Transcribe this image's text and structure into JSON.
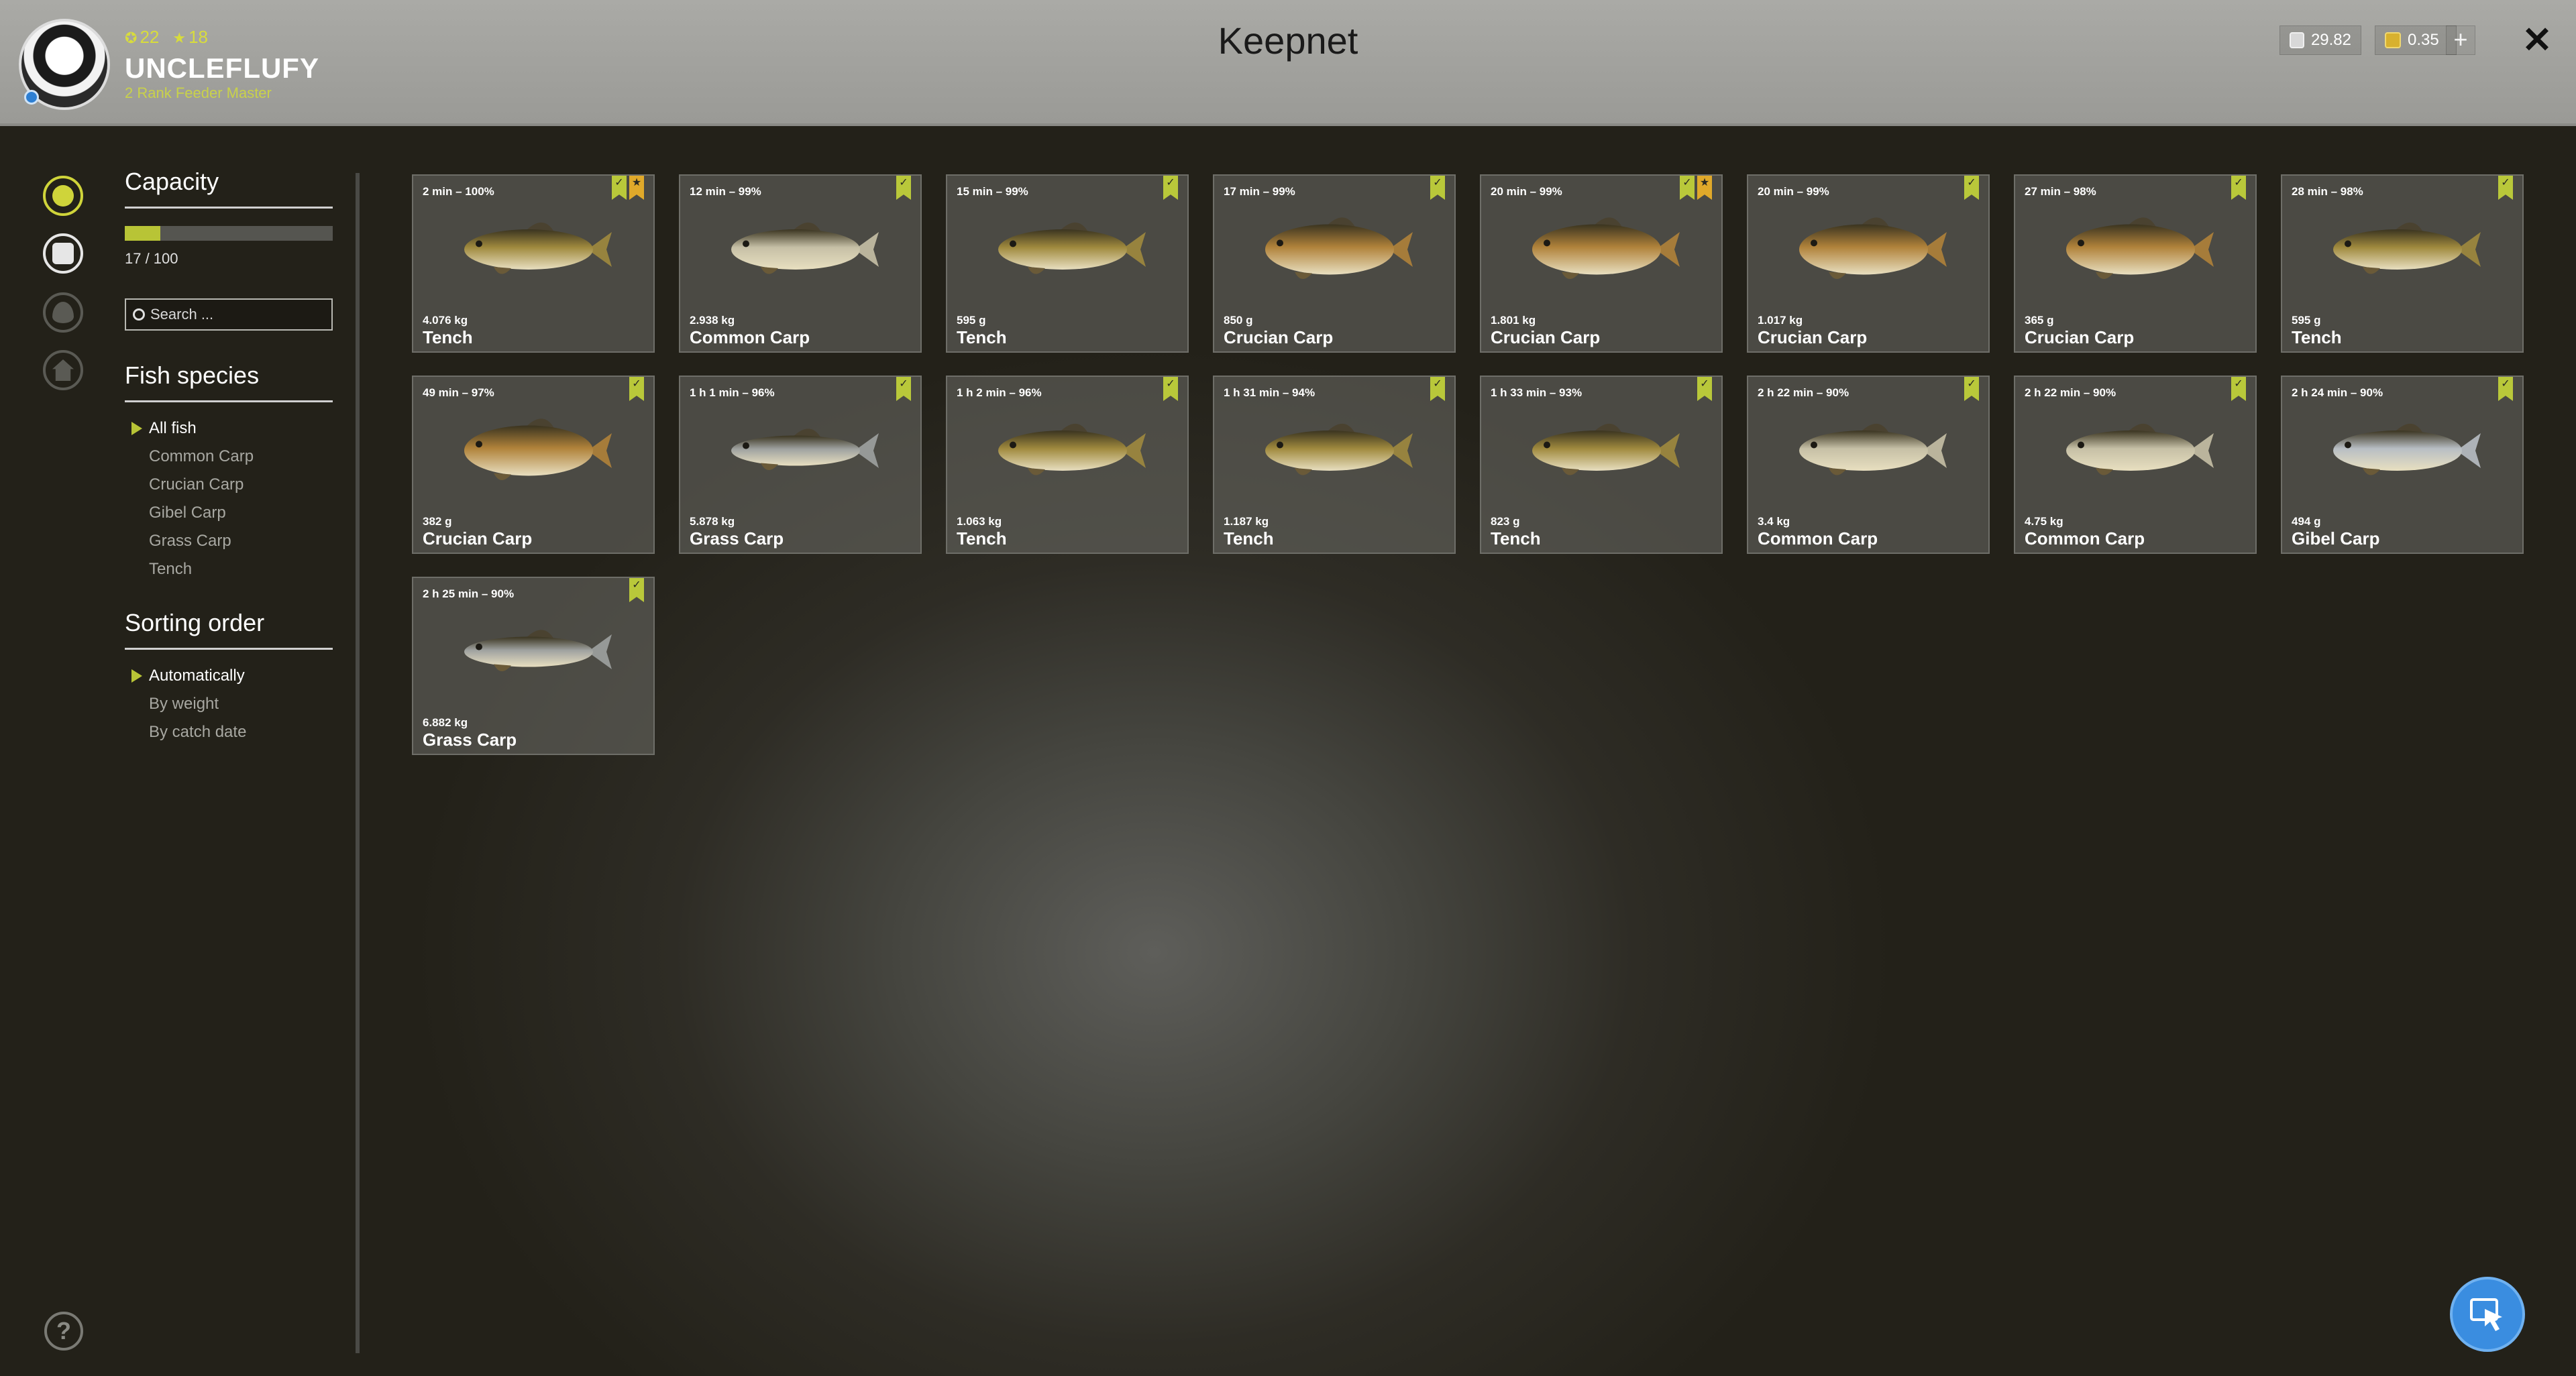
{
  "header": {
    "title": "Keepnet",
    "player": {
      "name": "UNCLEFLUFY",
      "rank": "2 Rank Feeder Master",
      "level": "22",
      "stars": "18"
    },
    "currency": {
      "silver": "29.82",
      "gold": "0.35"
    },
    "add_label": "+",
    "close_label": "✕"
  },
  "sidebar": {
    "capacity_title": "Capacity",
    "capacity_text": "17 / 100",
    "capacity_fraction": 0.17,
    "search_placeholder": "Search ...",
    "species_title": "Fish species",
    "species": [
      "All fish",
      "Common Carp",
      "Crucian Carp",
      "Gibel Carp",
      "Grass Carp",
      "Tench"
    ],
    "species_selected": 0,
    "sorting_title": "Sorting order",
    "sorting": [
      "Automatically",
      "By weight",
      "By catch date"
    ],
    "sorting_selected": 0
  },
  "help_label": "?",
  "colors": {
    "accent": "#b8c436",
    "star": "#e0a92a",
    "tench": "#a08a3e",
    "crucian": "#b0823a",
    "common": "#c6c0a6",
    "grass": "#9fa2a0",
    "gibel": "#b8bec4"
  },
  "fish": [
    {
      "meta": "2 min – 100%",
      "weight": "4.076 kg",
      "species": "Tench",
      "star": true,
      "kind": "tench"
    },
    {
      "meta": "12 min – 99%",
      "weight": "2.938 kg",
      "species": "Common Carp",
      "star": false,
      "kind": "common"
    },
    {
      "meta": "15 min – 99%",
      "weight": "595 g",
      "species": "Tench",
      "star": false,
      "kind": "tench"
    },
    {
      "meta": "17 min – 99%",
      "weight": "850 g",
      "species": "Crucian Carp",
      "star": false,
      "kind": "crucian"
    },
    {
      "meta": "20 min – 99%",
      "weight": "1.801 kg",
      "species": "Crucian Carp",
      "star": true,
      "kind": "crucian"
    },
    {
      "meta": "20 min – 99%",
      "weight": "1.017 kg",
      "species": "Crucian Carp",
      "star": false,
      "kind": "crucian"
    },
    {
      "meta": "27 min – 98%",
      "weight": "365 g",
      "species": "Crucian Carp",
      "star": false,
      "kind": "crucian"
    },
    {
      "meta": "28 min – 98%",
      "weight": "595 g",
      "species": "Tench",
      "star": false,
      "kind": "tench"
    },
    {
      "meta": "49 min – 97%",
      "weight": "382 g",
      "species": "Crucian Carp",
      "star": false,
      "kind": "crucian"
    },
    {
      "meta": "1 h 1 min – 96%",
      "weight": "5.878 kg",
      "species": "Grass Carp",
      "star": false,
      "kind": "grass"
    },
    {
      "meta": "1 h 2 min – 96%",
      "weight": "1.063 kg",
      "species": "Tench",
      "star": false,
      "kind": "tench"
    },
    {
      "meta": "1 h 31 min – 94%",
      "weight": "1.187 kg",
      "species": "Tench",
      "star": false,
      "kind": "tench"
    },
    {
      "meta": "1 h 33 min – 93%",
      "weight": "823 g",
      "species": "Tench",
      "star": false,
      "kind": "tench"
    },
    {
      "meta": "2 h 22 min – 90%",
      "weight": "3.4 kg",
      "species": "Common Carp",
      "star": false,
      "kind": "common"
    },
    {
      "meta": "2 h 22 min – 90%",
      "weight": "4.75 kg",
      "species": "Common Carp",
      "star": false,
      "kind": "common"
    },
    {
      "meta": "2 h 24 min – 90%",
      "weight": "494 g",
      "species": "Gibel Carp",
      "star": false,
      "kind": "gibel"
    },
    {
      "meta": "2 h 25 min – 90%",
      "weight": "6.882 kg",
      "species": "Grass Carp",
      "star": false,
      "kind": "grass"
    }
  ]
}
